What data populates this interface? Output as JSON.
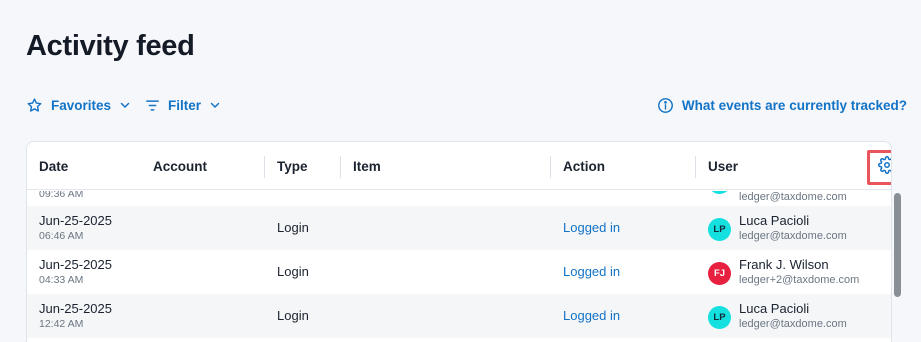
{
  "page": {
    "title": "Activity feed"
  },
  "toolbar": {
    "favorites_label": "Favorites",
    "filter_label": "Filter",
    "tracked_label": "What events are currently tracked?"
  },
  "table": {
    "headers": {
      "date": "Date",
      "account": "Account",
      "type": "Type",
      "item": "Item",
      "action": "Action",
      "user": "User"
    },
    "partial_row": {
      "time": "09:36 AM",
      "user_email": "ledger@taxdome.com",
      "avatar_color": "#14e0e0"
    },
    "rows": [
      {
        "date": "Jun-25-2025",
        "time": "06:46 AM",
        "type": "Login",
        "action": "Logged in",
        "user_initials": "LP",
        "user_name": "Luca Pacioli",
        "user_email": "ledger@taxdome.com",
        "avatar_color": "#14e0e0",
        "avatar_text_color": "#0f2a3a"
      },
      {
        "date": "Jun-25-2025",
        "time": "04:33 AM",
        "type": "Login",
        "action": "Logged in",
        "user_initials": "FJ",
        "user_name": "Frank J. Wilson",
        "user_email": "ledger+2@taxdome.com",
        "avatar_color": "#e8203f",
        "avatar_text_color": "#ffffff"
      },
      {
        "date": "Jun-25-2025",
        "time": "12:42 AM",
        "type": "Login",
        "action": "Logged in",
        "user_initials": "LP",
        "user_name": "Luca Pacioli",
        "user_email": "ledger@taxdome.com",
        "avatar_color": "#14e0e0",
        "avatar_text_color": "#0f2a3a"
      }
    ]
  },
  "colors": {
    "accent": "#1373c6",
    "highlight": "#e9555b"
  }
}
